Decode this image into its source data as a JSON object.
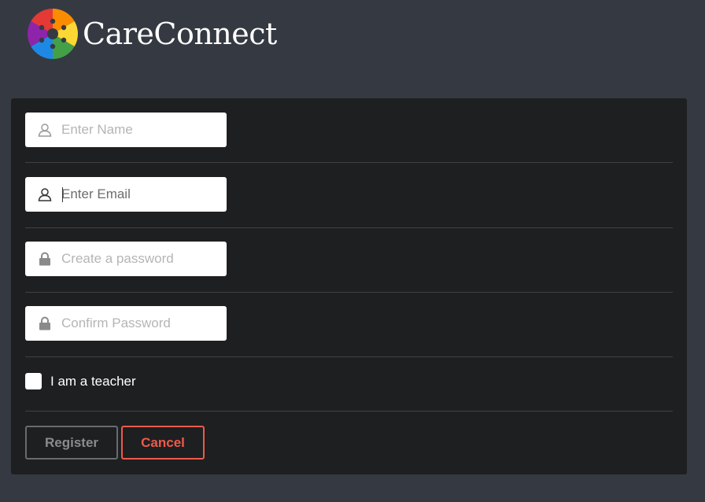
{
  "brand": {
    "name": "CareConnect",
    "colors": [
      "#e53935",
      "#fb8c00",
      "#fdd835",
      "#43a047",
      "#1e88e5",
      "#8e24aa"
    ]
  },
  "form": {
    "name_placeholder": "Enter Name",
    "email_placeholder": "Enter Email",
    "password_placeholder": "Create a password",
    "confirm_placeholder": "Confirm Password",
    "teacher_label": "I am a teacher",
    "register_label": "Register",
    "cancel_label": "Cancel",
    "icons": [
      "user-icon",
      "user-icon",
      "lock-icon",
      "lock-icon"
    ]
  },
  "colors": {
    "page_bg": "#353a42",
    "card_bg": "#1e1f21",
    "cancel_accent": "#f0594a"
  }
}
